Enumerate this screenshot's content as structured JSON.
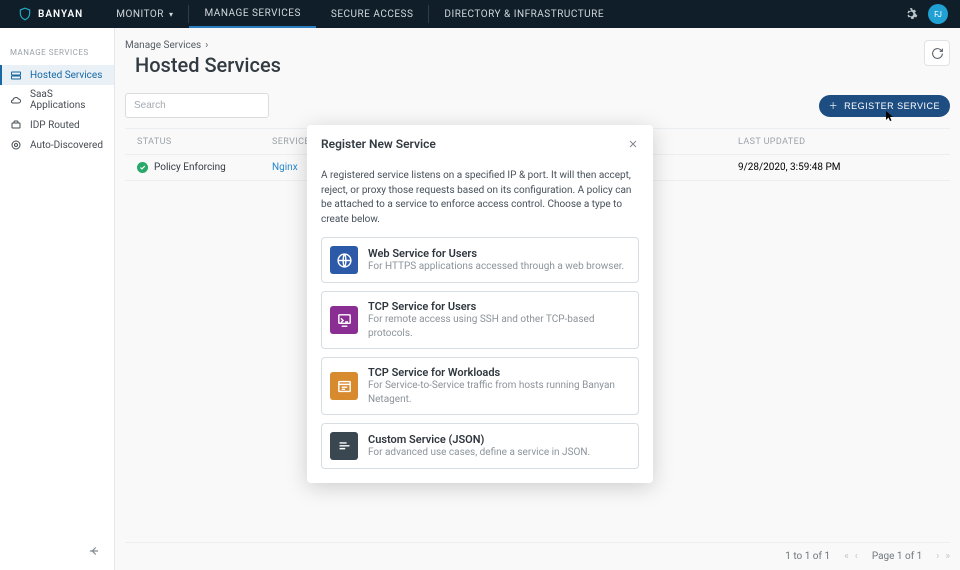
{
  "brand": "BANYAN",
  "nav": {
    "monitor": "MONITOR",
    "manage": "MANAGE SERVICES",
    "secure": "SECURE ACCESS",
    "directory": "DIRECTORY & INFRASTRUCTURE"
  },
  "avatar": "FJ",
  "sidebar": {
    "heading": "MANAGE SERVICES",
    "items": [
      {
        "label": "Hosted Services"
      },
      {
        "label": "SaaS Applications"
      },
      {
        "label": "IDP Routed"
      },
      {
        "label": "Auto-Discovered"
      }
    ]
  },
  "breadcrumb": "Manage Services",
  "pageTitle": "Hosted Services",
  "search": {
    "placeholder": "Search"
  },
  "registerBtn": "REGISTER SERVICE",
  "table": {
    "cols": {
      "status": "STATUS",
      "service": "SERVICE",
      "updated": "LAST UPDATED"
    },
    "rows": [
      {
        "status": "Policy Enforcing",
        "service": "Nginx",
        "updated": "9/28/2020, 3:59:48 PM"
      }
    ]
  },
  "pager": {
    "range": "1 to 1 of 1",
    "page": "Page  1  of  1"
  },
  "modal": {
    "title": "Register New Service",
    "desc": "A registered service listens on a specified IP & port. It will then accept, reject, or proxy those requests based on its configuration. A policy can be attached to a service to enforce access control. Choose a type to create below.",
    "options": [
      {
        "title": "Web Service for Users",
        "desc": "For HTTPS applications accessed through a web browser.",
        "color": "#2d5aa8"
      },
      {
        "title": "TCP Service for Users",
        "desc": "For remote access using SSH and other TCP-based protocols.",
        "color": "#8b2e94"
      },
      {
        "title": "TCP Service for Workloads",
        "desc": "For Service-to-Service traffic from hosts running Banyan Netagent.",
        "color": "#d88a2f"
      },
      {
        "title": "Custom Service (JSON)",
        "desc": "For advanced use cases, define a service in JSON.",
        "color": "#3a4750"
      }
    ]
  }
}
